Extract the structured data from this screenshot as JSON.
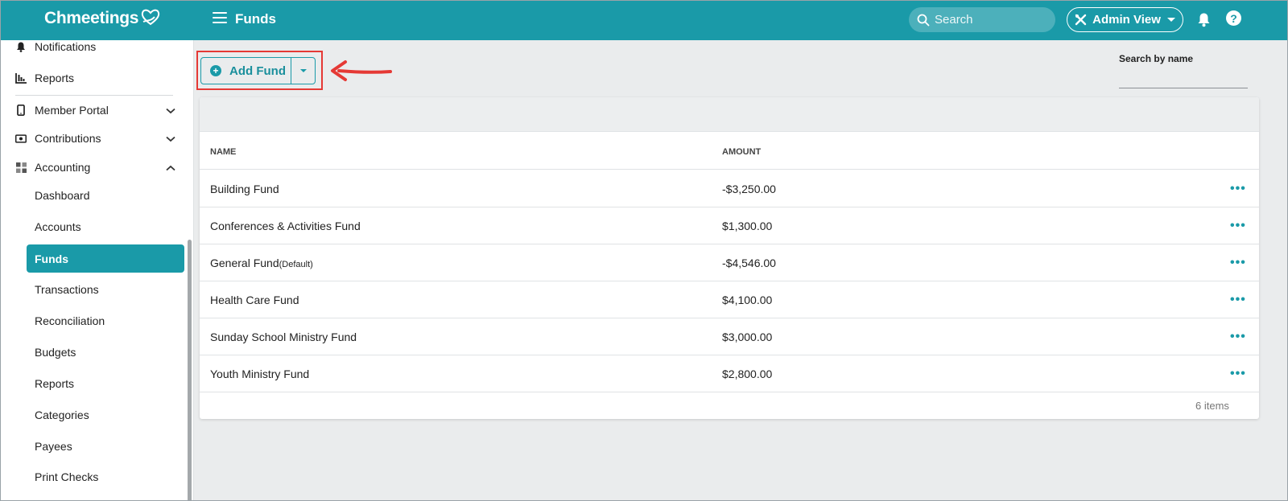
{
  "header": {
    "logo_text": "Chmeetings",
    "page_title": "Funds",
    "search_placeholder": "Search",
    "admin_view_label": "Admin View",
    "help_label": "?"
  },
  "sidebar": {
    "top_items": [
      {
        "label": "Notifications",
        "icon": "bell-icon"
      },
      {
        "label": "Reports",
        "icon": "bar-chart-icon"
      }
    ],
    "sections": [
      {
        "label": "Member Portal",
        "icon": "phone-icon",
        "expanded": false
      },
      {
        "label": "Contributions",
        "icon": "money-icon",
        "expanded": false
      },
      {
        "label": "Accounting",
        "icon": "grid-icon",
        "expanded": true
      }
    ],
    "accounting_items": [
      {
        "label": "Dashboard",
        "active": false
      },
      {
        "label": "Accounts",
        "active": false
      },
      {
        "label": "Funds",
        "active": true
      },
      {
        "label": "Transactions",
        "active": false
      },
      {
        "label": "Reconciliation",
        "active": false
      },
      {
        "label": "Budgets",
        "active": false
      },
      {
        "label": "Reports",
        "active": false
      },
      {
        "label": "Categories",
        "active": false
      },
      {
        "label": "Payees",
        "active": false
      },
      {
        "label": "Print Checks",
        "active": false
      }
    ]
  },
  "toolbar": {
    "add_fund_label": "Add Fund",
    "search_by_name_label": "Search by name"
  },
  "table": {
    "columns": [
      "NAME",
      "AMOUNT"
    ],
    "rows": [
      {
        "name": "Building Fund",
        "tag": "",
        "amount": "-$3,250.00"
      },
      {
        "name": "Conferences & Activities Fund",
        "tag": "",
        "amount": "$1,300.00"
      },
      {
        "name": "General Fund",
        "tag": "(Default)",
        "amount": "-$4,546.00"
      },
      {
        "name": "Health Care Fund",
        "tag": "",
        "amount": "$4,100.00"
      },
      {
        "name": "Sunday School Ministry Fund",
        "tag": "",
        "amount": "$3,000.00"
      },
      {
        "name": "Youth Ministry Fund",
        "tag": "",
        "amount": "$2,800.00"
      }
    ],
    "row_action_label": "•••",
    "item_count": "6 items"
  },
  "colors": {
    "brand": "#1a9aa8",
    "highlight": "#e53935"
  }
}
